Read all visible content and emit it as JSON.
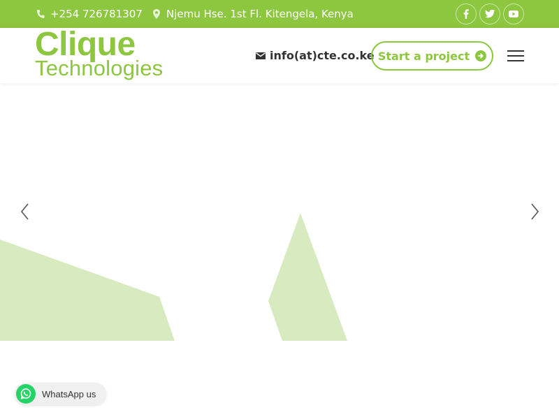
{
  "topbar": {
    "phone": "+254 726781307",
    "address": "Njemu Hse. 1st Fl. Kitengela, Kenya",
    "social": [
      "facebook-icon",
      "twitter-icon",
      "youtube-icon"
    ]
  },
  "header": {
    "logo_line1": "Clique",
    "logo_line2": "Technologies",
    "email": "info(at)cte.co.ke",
    "cta_label": "Start a project"
  },
  "slider": {
    "prev_icon": "chevron-left-icon",
    "next_icon": "chevron-right-icon"
  },
  "whatsapp": {
    "label": "WhatsApp us"
  },
  "colors": {
    "brand_green": "#8dc63f",
    "shape_green": "#d8eac0",
    "whatsapp_green": "#25d366"
  }
}
